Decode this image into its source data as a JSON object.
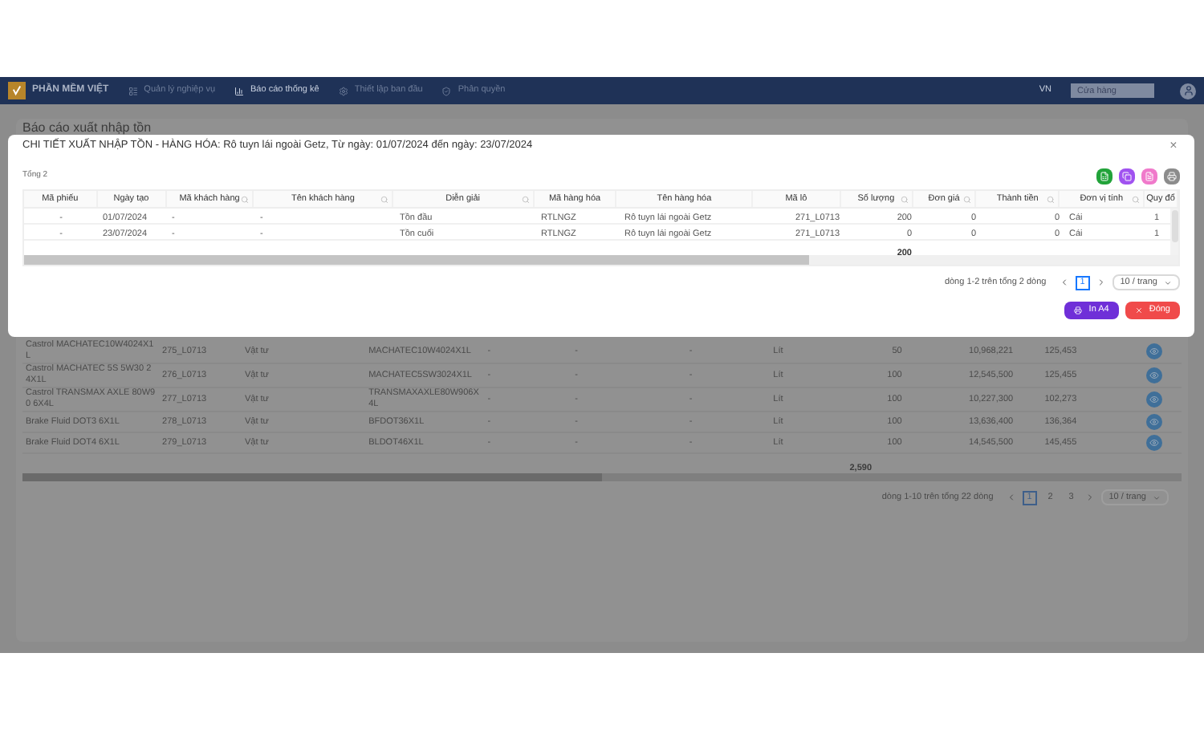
{
  "navbar": {
    "brand": "PHẦN MỀM VIỆT",
    "menu": [
      {
        "label": "Quản lý nghiệp vụ",
        "selected": false
      },
      {
        "label": "Báo cáo thống kê",
        "selected": true
      },
      {
        "label": "Thiết lập ban đầu",
        "selected": false
      },
      {
        "label": "Phân quyền",
        "selected": false
      }
    ],
    "language": "VN",
    "store_field": {
      "placeholder": "Cửa hàng"
    }
  },
  "report": {
    "title": "Báo cáo xuất nhập tồn",
    "rows": [
      {
        "name": "Castrol MACHATEC10W4024X1L",
        "lot": "275_L0713",
        "type": "Vật tư",
        "code": "MACHATEC10W4024X1L",
        "column_5": "-",
        "column_6": "-",
        "column_7": "-",
        "unit": "Lít",
        "quantity": "50",
        "amount": "10,968,221",
        "column_11": "125,453"
      },
      {
        "name": "Castrol MACHATEC 5S 5W30 24X1L",
        "lot": "276_L0713",
        "type": "Vật tư",
        "code": "MACHATEC5SW3024X1L",
        "column_5": "-",
        "column_6": "-",
        "column_7": "-",
        "unit": "Lít",
        "quantity": "100",
        "amount": "12,545,500",
        "column_11": "125,455"
      },
      {
        "name": "Castrol TRANSMAX AXLE 80W90 6X4L",
        "lot": "277_L0713",
        "type": "Vật tư",
        "code": "TRANSMAXAXLE80W906X4L",
        "column_5": "-",
        "column_6": "-",
        "column_7": "-",
        "unit": "Lít",
        "quantity": "100",
        "amount": "10,227,300",
        "column_11": "102,273"
      },
      {
        "name": "Brake Fluid DOT3 6X1L",
        "lot": "278_L0713",
        "type": "Vật tư",
        "code": "BFDOT36X1L",
        "column_5": "-",
        "column_6": "-",
        "column_7": "-",
        "unit": "Lít",
        "quantity": "100",
        "amount": "13,636,400",
        "column_11": "136,364"
      },
      {
        "name": "Brake Fluid DOT4 6X1L",
        "lot": "279_L0713",
        "type": "Vật tư",
        "code": "BLDOT46X1L",
        "column_5": "-",
        "column_6": "-",
        "column_7": "-",
        "unit": "Lít",
        "quantity": "100",
        "amount": "14,545,500",
        "column_11": "145,455"
      }
    ],
    "total_quantity": "2,590",
    "pagination": {
      "summary": "dòng 1-10 trên tổng 22 dòng",
      "pages": [
        {
          "label": "1",
          "selected": true
        },
        {
          "label": "2",
          "selected": false
        },
        {
          "label": "3",
          "selected": false
        }
      ],
      "page_size": "10 / trang"
    }
  },
  "dialog": {
    "title": "CHI TIẾT XUẤT NHẬP TỒN - HÀNG HÓA: Rô tuyn lái ngoài Getz, Từ ngày: 01/07/2024 đến ngày: 23/07/2024",
    "close": "×",
    "count": "Tổng 2",
    "toolbar_buttons": [
      {
        "color": "#22a33a"
      },
      {
        "color": "#a052f0"
      },
      {
        "color": "#f07acb"
      },
      {
        "color": "#8c8c8c"
      }
    ],
    "columns": [
      {
        "label": "Mã phiếu",
        "searchable": false
      },
      {
        "label": "Ngày tạo",
        "searchable": false
      },
      {
        "label": "Mã khách hàng",
        "searchable": true
      },
      {
        "label": "Tên khách hàng",
        "searchable": true
      },
      {
        "label": "Diễn giải",
        "searchable": true
      },
      {
        "label": "Mã hàng hóa",
        "searchable": false
      },
      {
        "label": "Tên hàng hóa",
        "searchable": false
      },
      {
        "label": "Mã lô",
        "searchable": false
      },
      {
        "label": "Số lượng",
        "searchable": true
      },
      {
        "label": "Đơn giá",
        "searchable": true
      },
      {
        "label": "Thành tiền",
        "searchable": true
      },
      {
        "label": "Đơn vị tính",
        "searchable": true
      },
      {
        "label": "Quy đổ",
        "searchable": false
      }
    ],
    "rows": [
      [
        "-",
        "01/07/2024",
        "-",
        "-",
        "Tồn đầu",
        "RTLNGZ",
        "Rô tuyn lái ngoài Getz",
        "271_L0713",
        "200",
        "0",
        "0",
        "Cái",
        "1"
      ],
      [
        "-",
        "23/07/2024",
        "-",
        "-",
        "Tồn cuối",
        "RTLNGZ",
        "Rô tuyn lái ngoài Getz",
        "271_L0713",
        "0",
        "0",
        "0",
        "Cái",
        "1"
      ]
    ],
    "total_quantity": "200",
    "pagination": {
      "summary": "dòng 1-2 trên tổng 2 dòng",
      "pages": [
        {
          "label": "1",
          "selected": true
        }
      ],
      "page_size": "10 / trang"
    },
    "buttons": [
      {
        "kind": "print",
        "label": "In A4"
      },
      {
        "kind": "close",
        "label": "Đóng"
      }
    ]
  }
}
